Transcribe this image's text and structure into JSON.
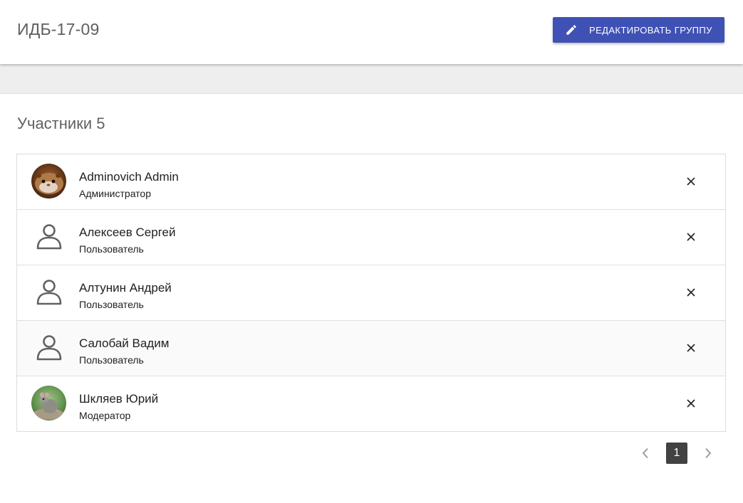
{
  "header": {
    "group_title": "ИДБ-17-09",
    "edit_button_label": "РЕДАКТИРОВАТЬ ГРУППУ",
    "edit_button_icon": "pencil-icon"
  },
  "members": {
    "title": "Участники 5",
    "items": [
      {
        "name": "Adminovich Admin",
        "role": "Администратор",
        "avatar": "photo-hamster"
      },
      {
        "name": "Алексеев Сергей",
        "role": "Пользователь",
        "avatar": "person-icon"
      },
      {
        "name": "Алтунин Андрей",
        "role": "Пользователь",
        "avatar": "person-icon"
      },
      {
        "name": "Салобай Вадим",
        "role": "Пользователь",
        "avatar": "person-icon"
      },
      {
        "name": "Шкляев Юрий",
        "role": "Модератор",
        "avatar": "photo-mouse"
      }
    ],
    "remove_icon": "close-icon"
  },
  "pagination": {
    "current_page": "1",
    "prev_icon": "chevron-left-icon",
    "next_icon": "chevron-right-icon"
  },
  "colors": {
    "accent": "#3f51b5",
    "band": "#eeeeee",
    "active_page": "#424242"
  }
}
